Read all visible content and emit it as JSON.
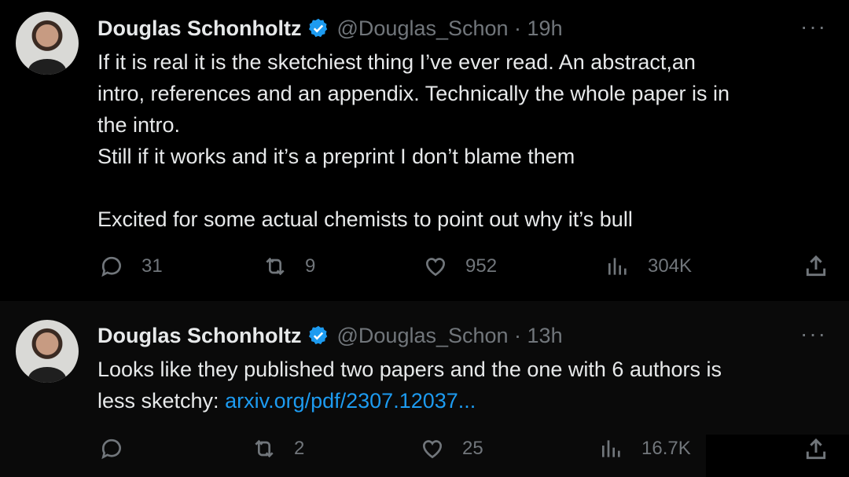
{
  "tweets": [
    {
      "author": {
        "name": "Douglas Schonholtz",
        "handle": "@Douglas_Schon · 19h"
      },
      "lines": [
        "If it is real it is the sketchiest thing I’ve ever read. An abstract,an",
        "intro, references and an appendix. Technically the whole paper is in",
        "the intro.",
        "Still if it works and it’s a preprint I don’t blame them",
        "",
        "Excited for some actual chemists to point out why it’s bull"
      ],
      "stats": {
        "replies": "31",
        "reposts": "9",
        "likes": "952",
        "views": "304K"
      }
    },
    {
      "author": {
        "name": "Douglas Schonholtz",
        "handle": "@Douglas_Schon · 13h"
      },
      "lines": [
        "Looks like they published two papers and the one with 6 authors is",
        "less sketchy: "
      ],
      "link": "arxiv.org/pdf/2307.12037...",
      "stats": {
        "replies": "",
        "reposts": "2",
        "likes": "25",
        "views": "16.7K"
      }
    }
  ],
  "more_label": "···",
  "icons": [
    "verified-badge-icon",
    "more-icon",
    "reply-icon",
    "repost-icon",
    "like-icon",
    "views-icon",
    "share-icon"
  ],
  "colors": {
    "background": "#000000",
    "text": "#e7e9ea",
    "secondary": "#71767b",
    "link": "#1d9bf0",
    "verified": "#1d9bf0"
  }
}
